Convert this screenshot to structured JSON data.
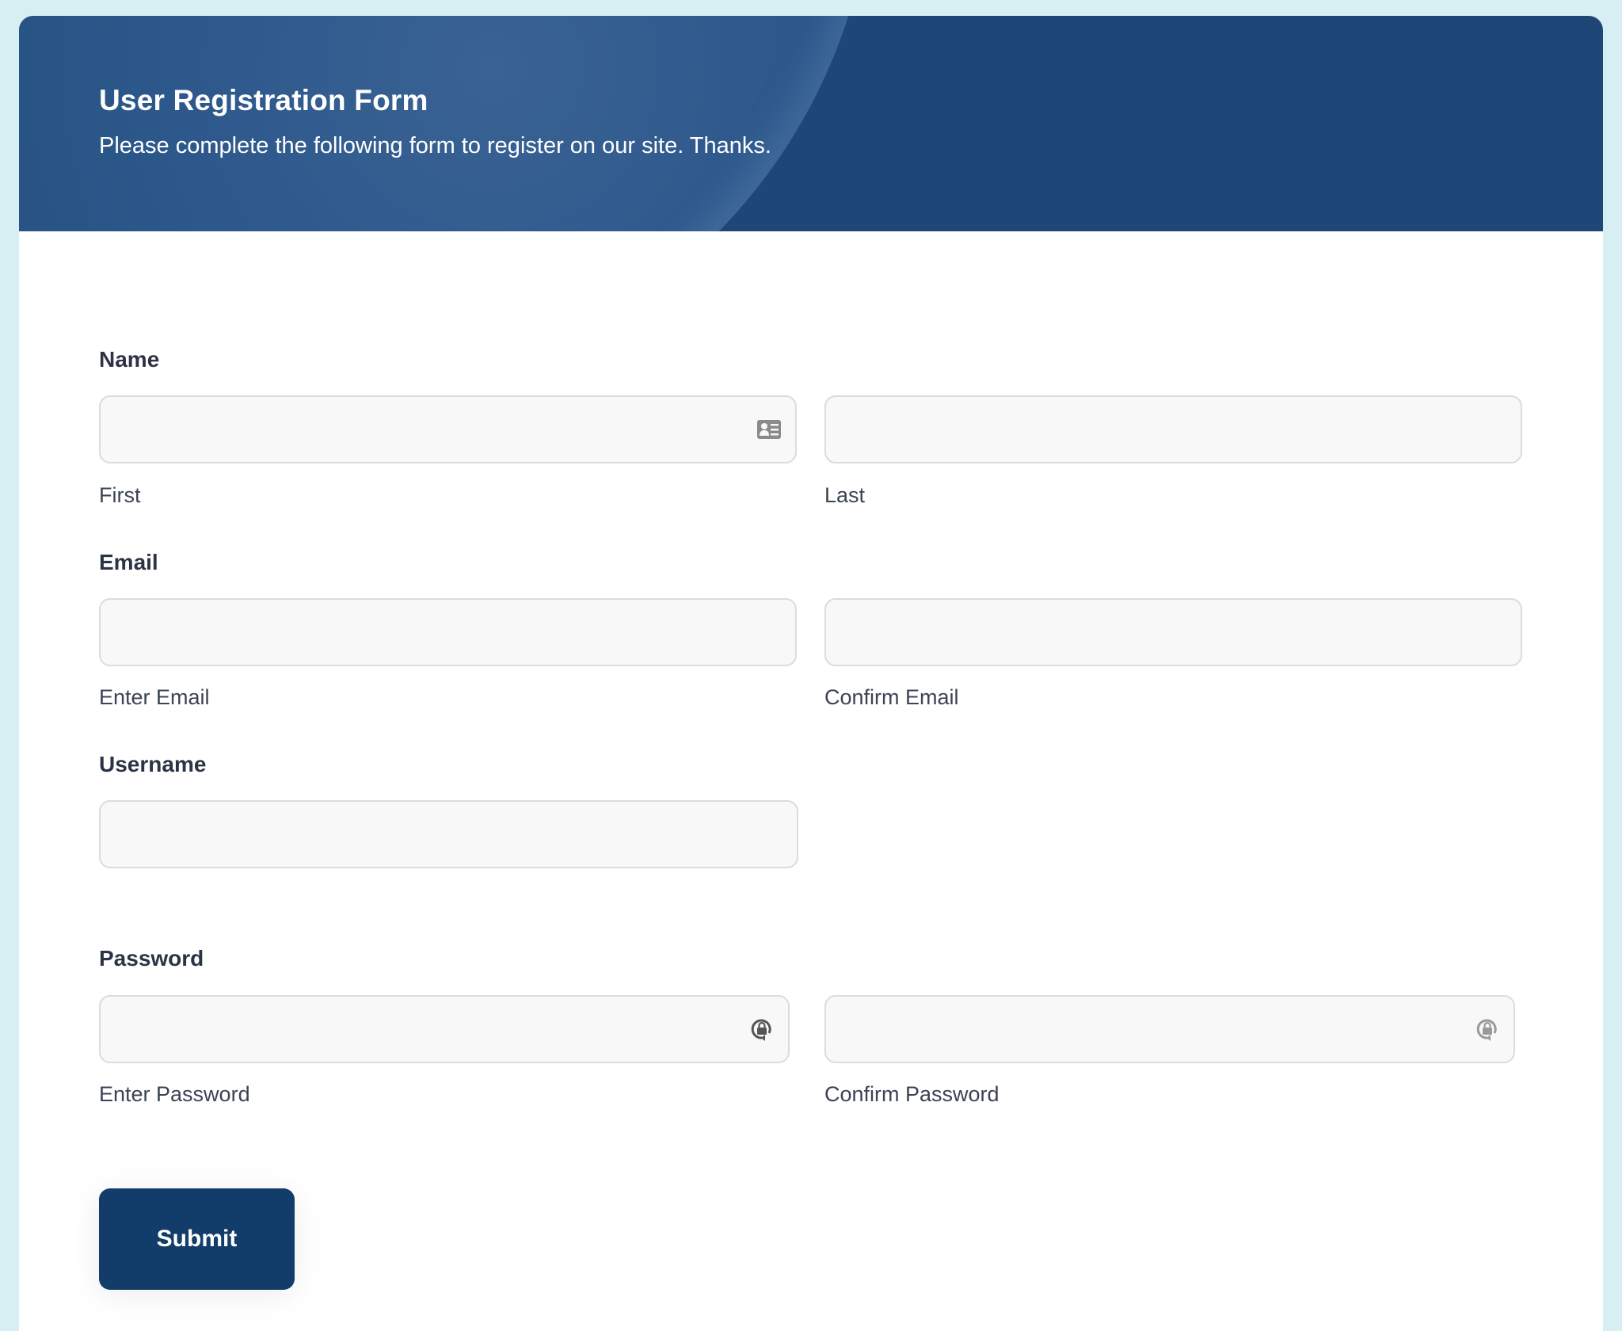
{
  "header": {
    "title": "User Registration Form",
    "subtitle": "Please complete the following form to register on our site. Thanks."
  },
  "form": {
    "name": {
      "label": "Name",
      "first": {
        "value": "",
        "placeholder": "",
        "sublabel": "First",
        "icon": "contact-card-icon"
      },
      "last": {
        "value": "",
        "placeholder": "",
        "sublabel": "Last"
      }
    },
    "email": {
      "label": "Email",
      "enter": {
        "value": "",
        "placeholder": "",
        "sublabel": "Enter Email"
      },
      "confirm": {
        "value": "",
        "placeholder": "",
        "sublabel": "Confirm Email"
      }
    },
    "username": {
      "label": "Username",
      "value": "",
      "placeholder": ""
    },
    "password": {
      "label": "Password",
      "enter": {
        "value": "",
        "placeholder": "",
        "sublabel": "Enter Password",
        "icon": "password-manager-lock-icon"
      },
      "confirm": {
        "value": "",
        "placeholder": "",
        "sublabel": "Confirm Password",
        "icon": "password-manager-lock-icon"
      }
    },
    "submit_label": "Submit"
  },
  "colors": {
    "page_background": "#d7eef2",
    "header_background": "#1e4677",
    "button_background": "#123c69",
    "label_text": "#2c3345",
    "field_background": "#f8f8f8",
    "field_border": "#dcdcdc"
  }
}
